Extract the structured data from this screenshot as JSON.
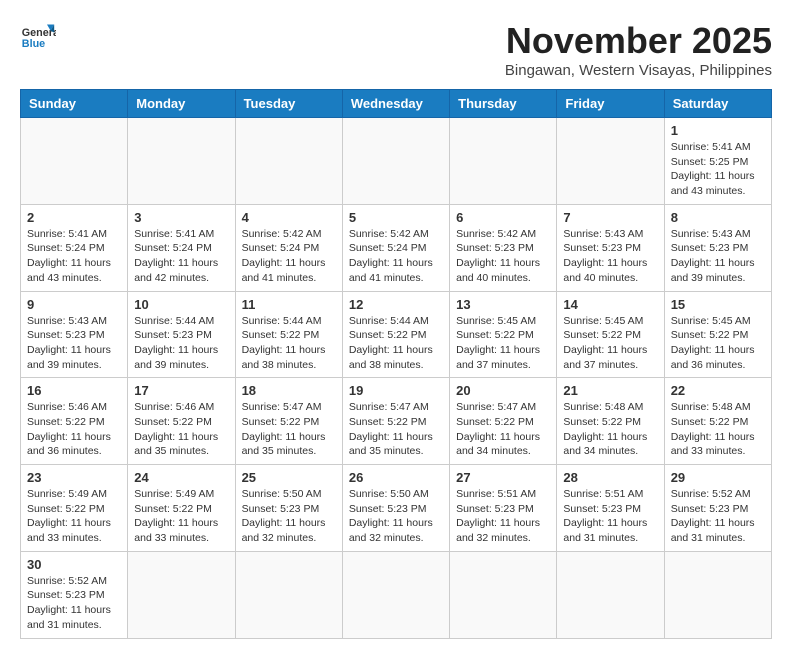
{
  "header": {
    "logo_general": "General",
    "logo_blue": "Blue",
    "month": "November 2025",
    "location": "Bingawan, Western Visayas, Philippines"
  },
  "days_of_week": [
    "Sunday",
    "Monday",
    "Tuesday",
    "Wednesday",
    "Thursday",
    "Friday",
    "Saturday"
  ],
  "weeks": [
    [
      {
        "day": "",
        "empty": true
      },
      {
        "day": "",
        "empty": true
      },
      {
        "day": "",
        "empty": true
      },
      {
        "day": "",
        "empty": true
      },
      {
        "day": "",
        "empty": true
      },
      {
        "day": "",
        "empty": true
      },
      {
        "day": "1",
        "sunrise": "5:41 AM",
        "sunset": "5:25 PM",
        "daylight": "11 hours and 43 minutes."
      }
    ],
    [
      {
        "day": "2",
        "sunrise": "5:41 AM",
        "sunset": "5:24 PM",
        "daylight": "11 hours and 43 minutes."
      },
      {
        "day": "3",
        "sunrise": "5:41 AM",
        "sunset": "5:24 PM",
        "daylight": "11 hours and 42 minutes."
      },
      {
        "day": "4",
        "sunrise": "5:42 AM",
        "sunset": "5:24 PM",
        "daylight": "11 hours and 41 minutes."
      },
      {
        "day": "5",
        "sunrise": "5:42 AM",
        "sunset": "5:24 PM",
        "daylight": "11 hours and 41 minutes."
      },
      {
        "day": "6",
        "sunrise": "5:42 AM",
        "sunset": "5:23 PM",
        "daylight": "11 hours and 40 minutes."
      },
      {
        "day": "7",
        "sunrise": "5:43 AM",
        "sunset": "5:23 PM",
        "daylight": "11 hours and 40 minutes."
      },
      {
        "day": "8",
        "sunrise": "5:43 AM",
        "sunset": "5:23 PM",
        "daylight": "11 hours and 39 minutes."
      }
    ],
    [
      {
        "day": "9",
        "sunrise": "5:43 AM",
        "sunset": "5:23 PM",
        "daylight": "11 hours and 39 minutes."
      },
      {
        "day": "10",
        "sunrise": "5:44 AM",
        "sunset": "5:23 PM",
        "daylight": "11 hours and 39 minutes."
      },
      {
        "day": "11",
        "sunrise": "5:44 AM",
        "sunset": "5:22 PM",
        "daylight": "11 hours and 38 minutes."
      },
      {
        "day": "12",
        "sunrise": "5:44 AM",
        "sunset": "5:22 PM",
        "daylight": "11 hours and 38 minutes."
      },
      {
        "day": "13",
        "sunrise": "5:45 AM",
        "sunset": "5:22 PM",
        "daylight": "11 hours and 37 minutes."
      },
      {
        "day": "14",
        "sunrise": "5:45 AM",
        "sunset": "5:22 PM",
        "daylight": "11 hours and 37 minutes."
      },
      {
        "day": "15",
        "sunrise": "5:45 AM",
        "sunset": "5:22 PM",
        "daylight": "11 hours and 36 minutes."
      }
    ],
    [
      {
        "day": "16",
        "sunrise": "5:46 AM",
        "sunset": "5:22 PM",
        "daylight": "11 hours and 36 minutes."
      },
      {
        "day": "17",
        "sunrise": "5:46 AM",
        "sunset": "5:22 PM",
        "daylight": "11 hours and 35 minutes."
      },
      {
        "day": "18",
        "sunrise": "5:47 AM",
        "sunset": "5:22 PM",
        "daylight": "11 hours and 35 minutes."
      },
      {
        "day": "19",
        "sunrise": "5:47 AM",
        "sunset": "5:22 PM",
        "daylight": "11 hours and 35 minutes."
      },
      {
        "day": "20",
        "sunrise": "5:47 AM",
        "sunset": "5:22 PM",
        "daylight": "11 hours and 34 minutes."
      },
      {
        "day": "21",
        "sunrise": "5:48 AM",
        "sunset": "5:22 PM",
        "daylight": "11 hours and 34 minutes."
      },
      {
        "day": "22",
        "sunrise": "5:48 AM",
        "sunset": "5:22 PM",
        "daylight": "11 hours and 33 minutes."
      }
    ],
    [
      {
        "day": "23",
        "sunrise": "5:49 AM",
        "sunset": "5:22 PM",
        "daylight": "11 hours and 33 minutes."
      },
      {
        "day": "24",
        "sunrise": "5:49 AM",
        "sunset": "5:22 PM",
        "daylight": "11 hours and 33 minutes."
      },
      {
        "day": "25",
        "sunrise": "5:50 AM",
        "sunset": "5:23 PM",
        "daylight": "11 hours and 32 minutes."
      },
      {
        "day": "26",
        "sunrise": "5:50 AM",
        "sunset": "5:23 PM",
        "daylight": "11 hours and 32 minutes."
      },
      {
        "day": "27",
        "sunrise": "5:51 AM",
        "sunset": "5:23 PM",
        "daylight": "11 hours and 32 minutes."
      },
      {
        "day": "28",
        "sunrise": "5:51 AM",
        "sunset": "5:23 PM",
        "daylight": "11 hours and 31 minutes."
      },
      {
        "day": "29",
        "sunrise": "5:52 AM",
        "sunset": "5:23 PM",
        "daylight": "11 hours and 31 minutes."
      }
    ],
    [
      {
        "day": "30",
        "sunrise": "5:52 AM",
        "sunset": "5:23 PM",
        "daylight": "11 hours and 31 minutes."
      },
      {
        "day": "",
        "empty": true
      },
      {
        "day": "",
        "empty": true
      },
      {
        "day": "",
        "empty": true
      },
      {
        "day": "",
        "empty": true
      },
      {
        "day": "",
        "empty": true
      },
      {
        "day": "",
        "empty": true
      }
    ]
  ],
  "labels": {
    "sunrise": "Sunrise:",
    "sunset": "Sunset:",
    "daylight": "Daylight:"
  }
}
